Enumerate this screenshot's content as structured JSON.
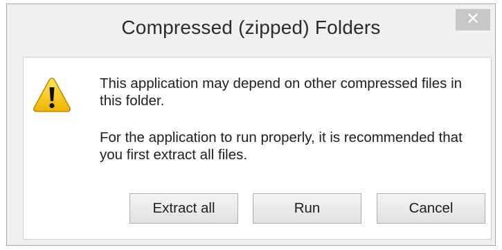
{
  "dialog": {
    "title": "Compressed (zipped) Folders",
    "close_glyph": "✕",
    "icon": "warning-icon",
    "message_primary": "This application may depend on other compressed files in this folder.",
    "message_secondary": "For the application to run properly, it is recommended that you first extract all files.",
    "buttons": {
      "extract_all": "Extract all",
      "run": "Run",
      "cancel": "Cancel"
    }
  },
  "colors": {
    "warning_yellow": "#f5c400",
    "close_button": "#c7c7c7"
  }
}
